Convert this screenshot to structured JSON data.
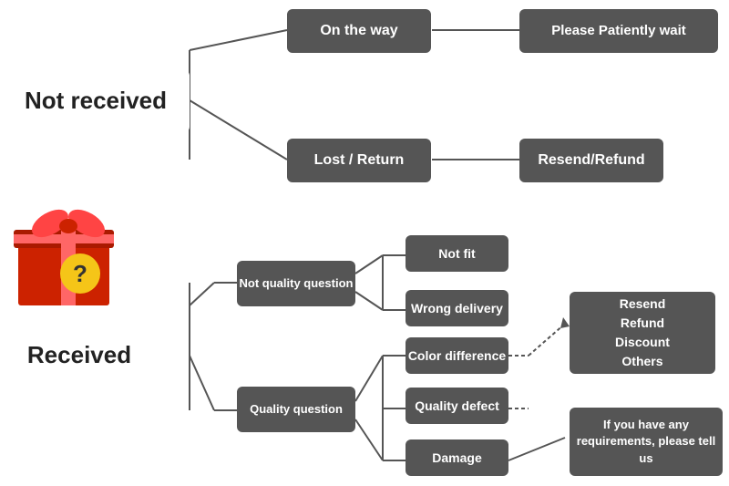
{
  "nodes": {
    "not_received": {
      "label": "Not received"
    },
    "on_the_way": {
      "label": "On the way"
    },
    "please_wait": {
      "label": "Please Patiently wait"
    },
    "lost_return": {
      "label": "Lost / Return"
    },
    "resend_refund1": {
      "label": "Resend/Refund"
    },
    "received": {
      "label": "Received"
    },
    "not_quality_q": {
      "label": "Not quality question"
    },
    "not_fit": {
      "label": "Not fit"
    },
    "wrong_delivery": {
      "label": "Wrong delivery"
    },
    "quality_question": {
      "label": "Quality question"
    },
    "color_difference": {
      "label": "Color difference"
    },
    "quality_defect": {
      "label": "Quality defect"
    },
    "damage": {
      "label": "Damage"
    },
    "resend_refund2": {
      "label": "Resend\nRefund\nDiscount\nOthers"
    },
    "if_requirements": {
      "label": "If you have any requirements, please tell us"
    }
  },
  "colors": {
    "node_bg": "#555555",
    "node_text": "#ffffff",
    "large_text": "#222222",
    "line_color": "#555555",
    "gift_red": "#cc2200",
    "gift_ribbon": "#ff4444",
    "question_yellow": "#f5c518"
  }
}
